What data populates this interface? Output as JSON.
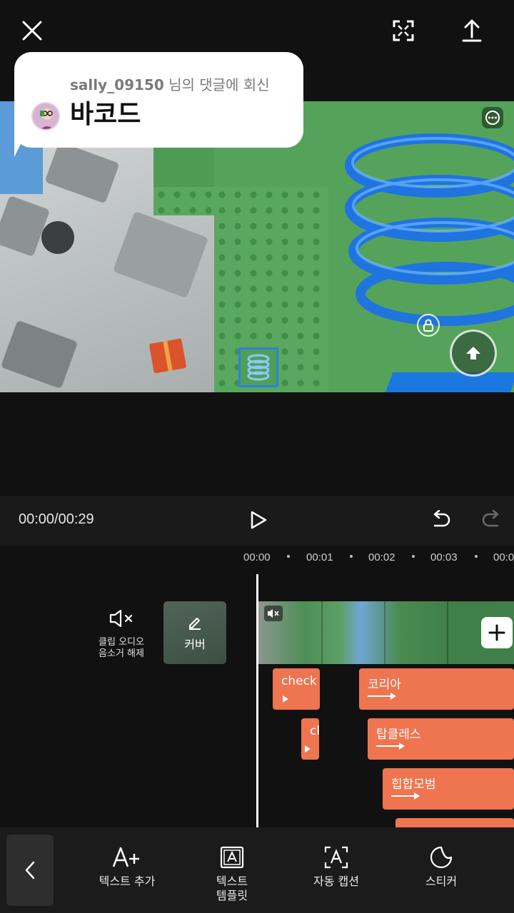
{
  "top_bar": {
    "close_icon": "close-icon",
    "fullscreen_icon": "fullscreen-icon",
    "export_icon": "upload-icon"
  },
  "comment_reply": {
    "username": "sally_09150",
    "reply_suffix": " 님의 댓글에 회신",
    "comment_text": "바코드"
  },
  "playback": {
    "time": "00:00/00:29",
    "play_icon": "play-icon",
    "undo_icon": "undo-icon",
    "redo_icon": "redo-icon"
  },
  "timeline": {
    "ticks": [
      "00:00",
      "00:01",
      "00:02",
      "00:03",
      "00:0"
    ],
    "mute_label_line1": "클립 오디오",
    "mute_label_line2": "음소거 해제",
    "cover_label": "커버",
    "text_clips": [
      {
        "label": "check"
      },
      {
        "label": "코리아"
      },
      {
        "label": "cl"
      },
      {
        "label": "탑클레스"
      },
      {
        "label": "힙합모범"
      }
    ]
  },
  "toolbar": {
    "items": [
      {
        "label": "텍스트 추가",
        "icon": "text-add-icon"
      },
      {
        "label_line1": "텍스트",
        "label_line2": "템플릿",
        "icon": "text-template-icon"
      },
      {
        "label": "자동 캡션",
        "icon": "auto-caption-icon"
      },
      {
        "label": "스티커",
        "icon": "sticker-icon"
      }
    ]
  },
  "colors": {
    "accent_clip": "#ee7550",
    "background": "#111111"
  }
}
